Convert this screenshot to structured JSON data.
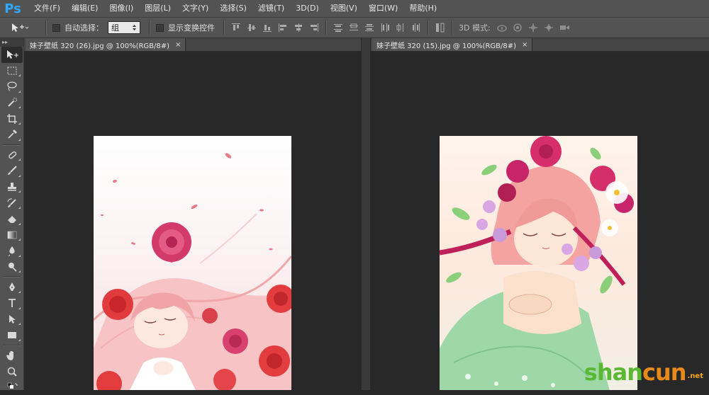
{
  "app": {
    "logo_text": "Ps"
  },
  "menu": {
    "items": [
      "文件(F)",
      "编辑(E)",
      "图像(I)",
      "图层(L)",
      "文字(Y)",
      "选择(S)",
      "滤镜(T)",
      "3D(D)",
      "视图(V)",
      "窗口(W)",
      "帮助(H)"
    ]
  },
  "options": {
    "auto_select_label": "自动选择：",
    "auto_select_value": "组",
    "show_transform_label": "显示变换控件",
    "mode3d_label": "3D 模式:"
  },
  "toolbar": {
    "collapse_glyph": "▸▸"
  },
  "documents": [
    {
      "title": "妹子壁纸 320 (26).jpg @ 100%(RGB/8#)",
      "close": "×"
    },
    {
      "title": "妹子壁纸 320 (15).jpg @ 100%(RGB/8#)",
      "close": "×"
    }
  ],
  "watermark": {
    "part1": "shan",
    "part2": "cun",
    "suffix": ".net",
    "color1": "#5bb834",
    "color2": "#e88a1a"
  }
}
